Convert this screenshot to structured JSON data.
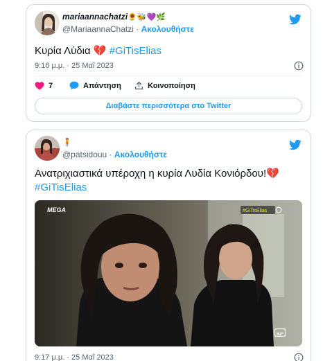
{
  "tweets": [
    {
      "display_name": "mariaannachatzi",
      "display_emojis": "🌻🐝💜🌿",
      "handle": "@MariaannaChatzi",
      "separator": "·",
      "follow_label": "Ακολουθήστε",
      "text": "Κυρία Λύδια 💔",
      "hashtag": "#GiTisElias",
      "timestamp": "9:16 μ.μ. · 25 Μαΐ 2023",
      "likes": "7",
      "reply_label": "Απάντηση",
      "share_label": "Κοινοποίηση",
      "read_more_label": "Διαβάστε περισσότερα στο Twitter"
    },
    {
      "display_emojis": "🧍",
      "handle": "@patsidouu",
      "separator": "·",
      "follow_label": "Ακολουθήστε",
      "text": "Ανατριχιαστικά υπέροχη η κυρία Λυδία Κονιόρδου!💔",
      "hashtag": "#GiTisElias",
      "timestamp": "9:17 μ.μ. · 25 Μαΐ 2023",
      "video": {
        "channel_logo": "MEGA",
        "badge": "#GiTisElias"
      }
    }
  ],
  "colors": {
    "accent": "#1d9bf0",
    "like": "#f91880",
    "muted": "#536471",
    "border": "#cfd9de"
  },
  "icons": [
    "twitter-bird-icon",
    "info-icon",
    "heart-icon",
    "reply-bubble-icon",
    "share-icon",
    "subtitles-icon"
  ]
}
